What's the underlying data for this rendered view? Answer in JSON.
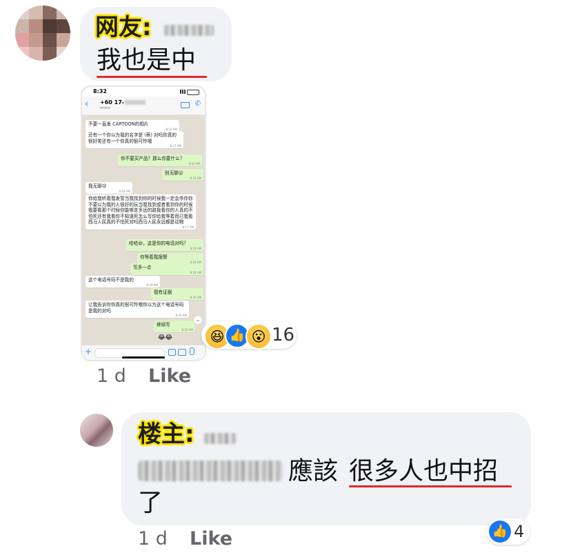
{
  "comment1": {
    "tag": "网友:",
    "text_plain": "我也是中",
    "reaction_count": "16",
    "time": "1 d",
    "like": "Like"
  },
  "phone": {
    "status_time": "8:32",
    "contact_number": "+60 17-",
    "contact_status": "online",
    "messages": [
      {
        "dir": "in",
        "text": "不要一直发 CARTOON的相片",
        "time": "8:14 AM"
      },
      {
        "dir": "in",
        "text": "还有一个你以为我的名字是 (蔡) 对吗你真的很好笑还有一个你真的很可怜哦",
        "time": "8:15 AM"
      },
      {
        "dir": "out",
        "text": "你不要买产品？那么你要什么？",
        "time": "8:16 AM"
      },
      {
        "dir": "out",
        "text": "别无聊😮",
        "time": "8:16 AM"
      },
      {
        "dir": "in",
        "text": "我无聊😡",
        "time": "8:16 AM"
      },
      {
        "dir": "in",
        "text": "你给我听着我发誓当我找到你的时候我一定会杀你你不要以为我的人很好的玩当我找到或者看到你的时候我要看那个时候你能够走多远的路我看你的人真的不怕死还有我看你不知道死怎么写你给我等着而已我看西马人民真的不怕死对吗西马人民永远都是动物",
        "time": "8:17 AM"
      },
      {
        "dir": "out",
        "text": "哈哈😆，这是你的电话对吗？",
        "time": "8:18 AM"
      },
      {
        "dir": "out",
        "text": "你等着我报警",
        "time": "8:18 AM"
      },
      {
        "dir": "out",
        "text": "写多一点",
        "time": "8:18 AM"
      },
      {
        "dir": "in",
        "text": "这个电话号码不是我的",
        "time": "8:19 AM"
      },
      {
        "dir": "out",
        "text": "我有证据",
        "time": "8:20 AM"
      },
      {
        "dir": "in",
        "text": "让我告诉你你真的很可怜哦你以为这个电话号码是我的对吗",
        "time": "8:20 AM"
      },
      {
        "dir": "out",
        "text": "继续写",
        "time": "8:20 AM"
      }
    ]
  },
  "comment2": {
    "tag": "楼主:",
    "text_line1": "應該",
    "text_line1_underlined": "很多人也中招",
    "text_line2": "了",
    "reaction_count": "4",
    "time": "1 d",
    "like": "Like"
  },
  "colors": {
    "bubble": "#f0f2f5",
    "underline": "#e0262e",
    "tag_highlight": "#ffe400",
    "meta_gray": "#65676b",
    "like_blue": "#1877f2"
  }
}
